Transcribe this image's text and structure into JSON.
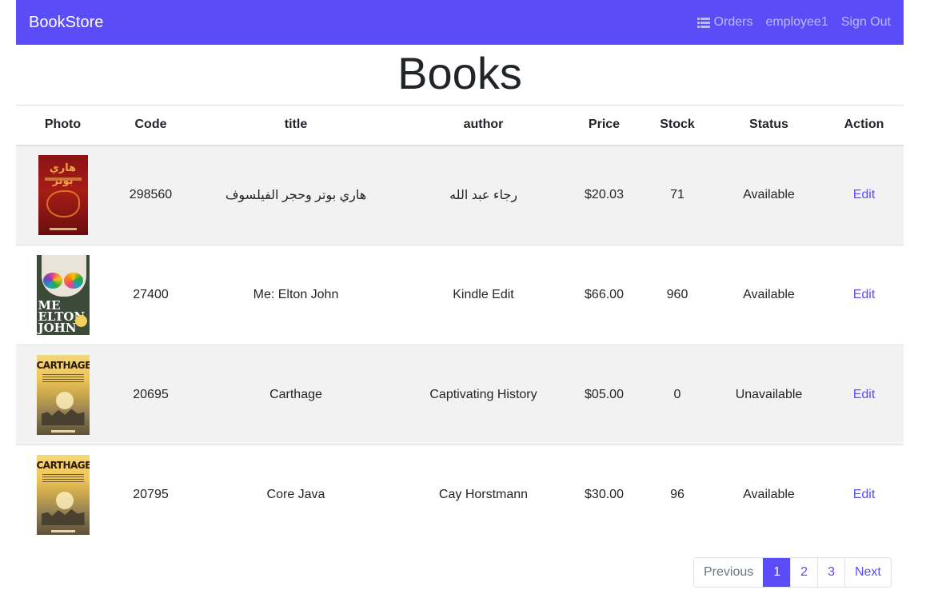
{
  "navbar": {
    "brand": "BookStore",
    "orders_label": "Orders",
    "orders_icon": "list-icon",
    "user": "employee1",
    "sign_out": "Sign Out",
    "accent_color": "#5a4df7"
  },
  "page": {
    "title": "Books"
  },
  "table": {
    "headers": [
      "Photo",
      "Code",
      "title",
      "author",
      "Price",
      "Stock",
      "Status",
      "Action"
    ],
    "rows": [
      {
        "cover": "cover-image",
        "cover_text": "هاري بوتر",
        "code": "298560",
        "title": "هاري بوتر وحجر الفيلسوف",
        "author": "رجاء عبد الله",
        "price": "$20.03",
        "stock": "71",
        "status": "Available",
        "action": "Edit"
      },
      {
        "cover": "cover-image",
        "cover_text": "ME ELTON JOHN",
        "code": "27400",
        "title": "Me: Elton John",
        "author": "Kindle Edit",
        "price": "$66.00",
        "stock": "960",
        "status": "Available",
        "action": "Edit"
      },
      {
        "cover": "cover-image",
        "cover_text": "CARTHAGE",
        "code": "20695",
        "title": "Carthage",
        "author": "Captivating History",
        "price": "$05.00",
        "stock": "0",
        "status": "Unavailable",
        "action": "Edit"
      },
      {
        "cover": "cover-image",
        "cover_text": "CARTHAGE",
        "code": "20795",
        "title": "Core Java",
        "author": "Cay Horstmann",
        "price": "$30.00",
        "stock": "96",
        "status": "Available",
        "action": "Edit"
      }
    ]
  },
  "pagination": {
    "previous": "Previous",
    "pages": [
      "1",
      "2",
      "3"
    ],
    "current": "1",
    "next": "Next"
  }
}
